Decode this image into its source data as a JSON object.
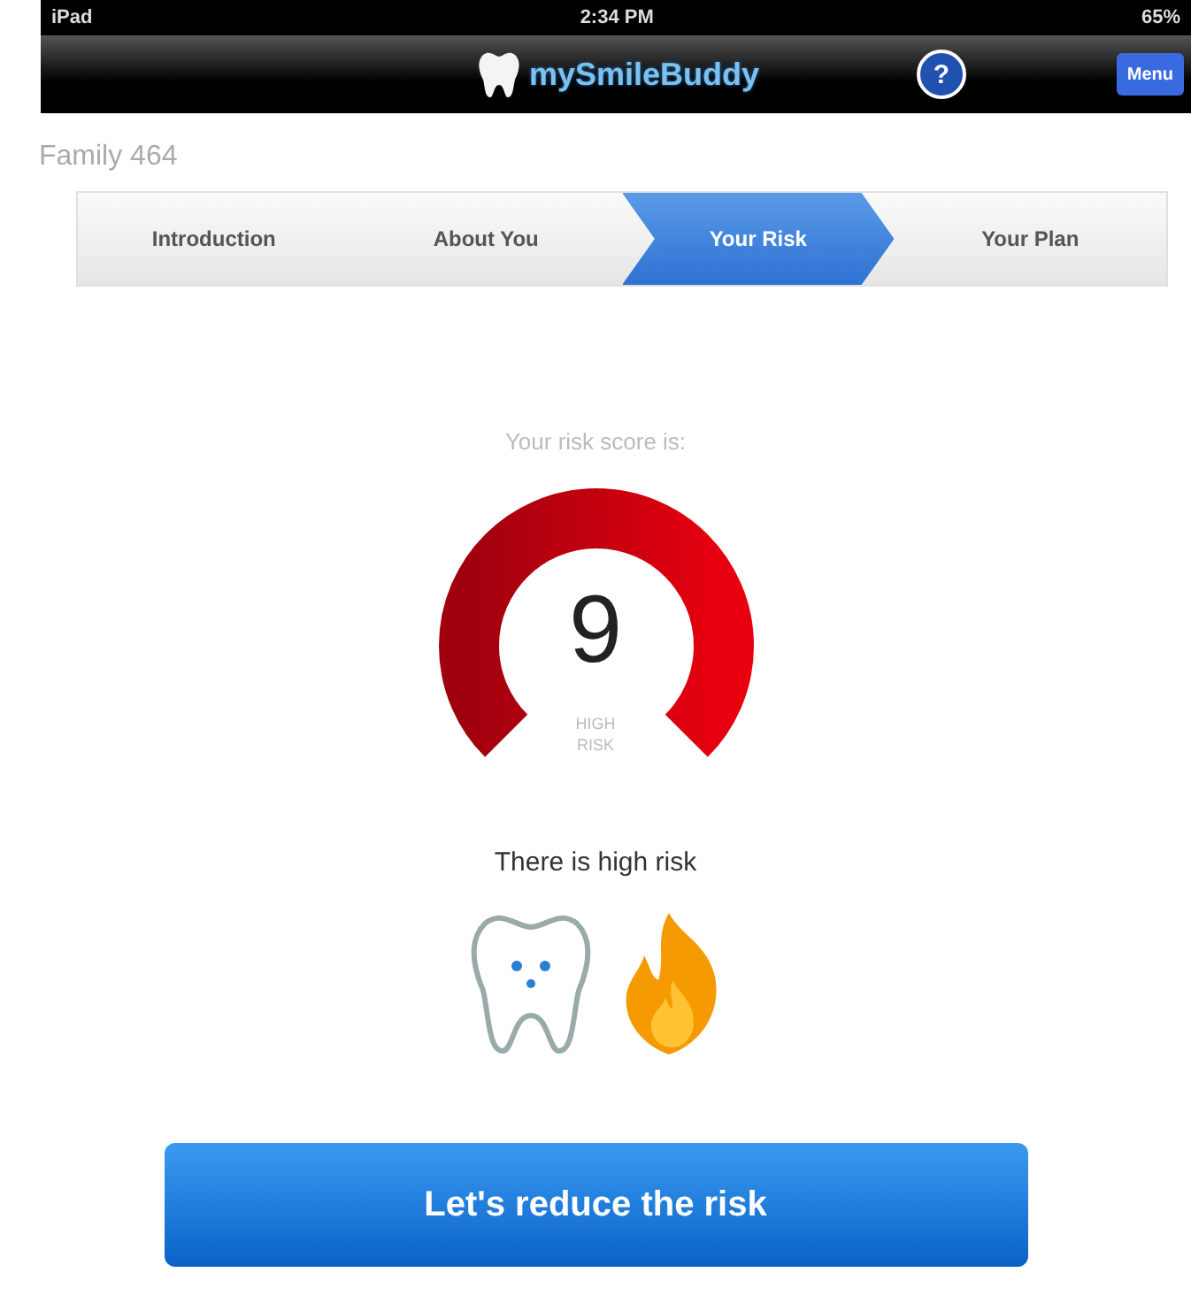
{
  "status_bar": {
    "device": "iPad",
    "time": "2:34 PM",
    "battery": "65%"
  },
  "nav_bar": {
    "logo": "mySmileBuddy",
    "help": "?",
    "menu": "Menu"
  },
  "family": "Family 464",
  "steps": [
    {
      "label": "Introduction",
      "selected": false
    },
    {
      "label": "About You",
      "selected": false
    },
    {
      "label": "Your Risk",
      "selected": true
    },
    {
      "label": "Your Plan",
      "selected": false
    }
  ],
  "score_label": "Your risk score is:",
  "gauge": {
    "score": "9",
    "caption_1": "HIGH",
    "caption_2": "RISK"
  },
  "risk_message": "There is high risk",
  "action_button": "Let's reduce the risk"
}
